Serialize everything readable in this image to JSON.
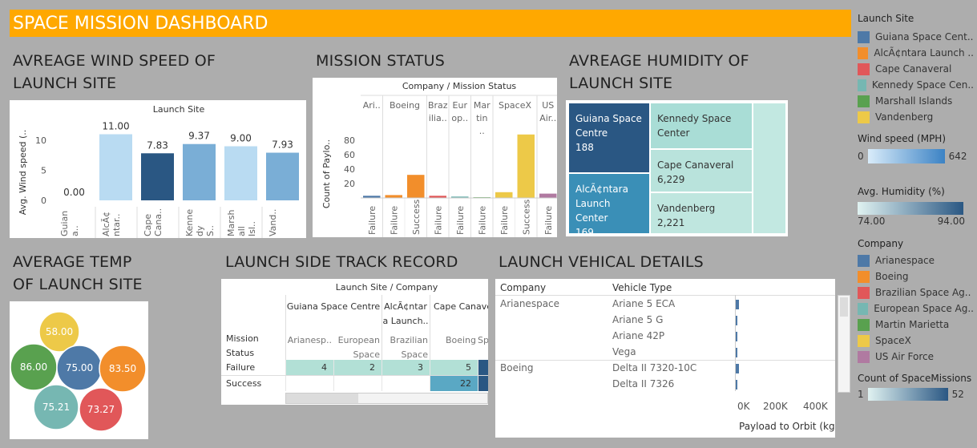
{
  "dashboard_title": "SPACE MISSION DASHBOARD",
  "sections": {
    "wind": "AVREAGE WIND SPEED OF LAUNCH SITE",
    "status": "MISSION STATUS",
    "humidity": "AVREAGE HUMIDITY OF LAUNCH SITE",
    "temp": "AVERAGE TEMP OF LAUNCH SITE",
    "track": "LAUNCH SIDE TRACK RECORD",
    "vehicle": "LAUNCH VEHICAL DETAILS"
  },
  "colors": {
    "banner": "#ffa800",
    "guiana": "#4e79a7",
    "alcantara": "#f28e2b",
    "cape": "#e15759",
    "kennedy": "#76b7b2",
    "marshall": "#59a14f",
    "vandenberg": "#edc948",
    "spacex": "#edc948",
    "usaf": "#b07aa1"
  },
  "wind_chart": {
    "header": "Launch Site",
    "ylabel": "Avg. Wind speed (..",
    "yticks": [
      "0",
      "5",
      "10"
    ],
    "bars": [
      {
        "label": "0.00",
        "cat": "Guian a..",
        "value": 0.0,
        "color": "#b9dbf2"
      },
      {
        "label": "11.00",
        "cat": "AlcÃ¢ ntar..",
        "value": 11.0,
        "color": "#b9dbf2"
      },
      {
        "label": "7.83",
        "cat": "Cape Cana..",
        "value": 7.83,
        "color": "#2a5783"
      },
      {
        "label": "9.37",
        "cat": "Kenne dy S..",
        "value": 9.37,
        "color": "#7aaed6"
      },
      {
        "label": "9.00",
        "cat": "Marsh all Isl..",
        "value": 9.0,
        "color": "#b9dbf2"
      },
      {
        "label": "7.93",
        "cat": "Vand..",
        "value": 7.93,
        "color": "#7aaed6"
      }
    ],
    "ymax": 12
  },
  "status_chart": {
    "header": "Company / Mission Status",
    "ylabel": "Count of Paylo..",
    "yticks": [
      "20",
      "40",
      "60",
      "80"
    ],
    "groups": [
      "Ari..",
      "Boeing",
      "Braz ilia..",
      "Eur op..",
      "Mar tin ..",
      "SpaceX",
      "US Air.."
    ],
    "bars": [
      {
        "cat": "Failure",
        "value": 3,
        "color": "#4e79a7"
      },
      {
        "cat": "Failure",
        "value": 4,
        "color": "#f28e2b"
      },
      {
        "cat": "Success",
        "value": 32,
        "color": "#f28e2b"
      },
      {
        "cat": "Failure",
        "value": 3,
        "color": "#e15759"
      },
      {
        "cat": "Failure",
        "value": 2,
        "color": "#76b7b2"
      },
      {
        "cat": "Failure",
        "value": 1,
        "color": "#59a14f"
      },
      {
        "cat": "Failure",
        "value": 8,
        "color": "#edc948"
      },
      {
        "cat": "Success",
        "value": 88,
        "color": "#edc948"
      },
      {
        "cat": "Failure",
        "value": 6,
        "color": "#b07aa1"
      }
    ],
    "ymax": 100
  },
  "treemap": [
    {
      "name": "Guiana Space Centre",
      "value": "188",
      "color": "#2a5783"
    },
    {
      "name": "AlcÃ¢ntara Launch Center",
      "value": "169",
      "color": "#3a8fb7"
    },
    {
      "name": "Kennedy Space Center",
      "value": "",
      "color": "#a9ddd6"
    },
    {
      "name": "Cape Canaveral",
      "value": "6,229",
      "color": "#b9e3dc"
    },
    {
      "name": "Vandenberg",
      "value": "2,221",
      "color": "#bfe6df"
    },
    {
      "name": "",
      "value": "",
      "color": "#c2e8e1"
    }
  ],
  "bubbles": [
    {
      "value": "58.00",
      "color": "#edc948"
    },
    {
      "value": "86.00",
      "color": "#59a14f"
    },
    {
      "value": "75.00",
      "color": "#4e79a7"
    },
    {
      "value": "83.50",
      "color": "#f28e2b"
    },
    {
      "value": "75.21",
      "color": "#76b7b2"
    },
    {
      "value": "73.27",
      "color": "#e15759"
    }
  ],
  "track": {
    "header": "Launch Site / Company",
    "row_header": "Mission Status",
    "sites": [
      "Guiana Space Centre",
      "AlcÃ¢ntar a Launch..",
      "Cape Canave.."
    ],
    "companies": [
      "Arianesp..",
      "European Space Ag..",
      "Brazilian Space Ag..",
      "Boeing",
      "Sp"
    ],
    "rows": [
      {
        "label": "Failure",
        "cells": [
          "4",
          "2",
          "3",
          "5",
          ""
        ]
      },
      {
        "label": "Success",
        "cells": [
          "",
          "",
          "",
          "22",
          ""
        ]
      }
    ]
  },
  "vehicle": {
    "col_company": "Company",
    "col_type": "Vehicle Type",
    "groups": [
      {
        "company": "Arianespace",
        "types": [
          "Ariane 5 ECA",
          "Ariane 5 G",
          "Ariane 42P",
          "Vega"
        ]
      },
      {
        "company": "Boeing",
        "types": [
          "Delta II 7320-10C",
          "Delta II 7326"
        ]
      }
    ],
    "axis_ticks": [
      "0K",
      "200K",
      "400K"
    ],
    "axis_label": "Payload to Orbit (kg)"
  },
  "legend": {
    "site_title": "Launch Site",
    "sites": [
      {
        "label": "Guiana Space Cent..",
        "color": "#4e79a7"
      },
      {
        "label": "AlcÃ¢ntara Launch ..",
        "color": "#f28e2b"
      },
      {
        "label": "Cape Canaveral",
        "color": "#e15759"
      },
      {
        "label": "Kennedy Space Cen..",
        "color": "#76b7b2"
      },
      {
        "label": "Marshall Islands",
        "color": "#59a14f"
      },
      {
        "label": "Vandenberg",
        "color": "#edc948"
      }
    ],
    "wind_title": "Wind speed (MPH)",
    "wind_min": "0",
    "wind_max": "642",
    "hum_title": "Avg. Humidity (%)",
    "hum_min": "74.00",
    "hum_max": "94.00",
    "company_title": "Company",
    "companies": [
      {
        "label": "Arianespace",
        "color": "#4e79a7"
      },
      {
        "label": "Boeing",
        "color": "#f28e2b"
      },
      {
        "label": "Brazilian Space Ag..",
        "color": "#e15759"
      },
      {
        "label": "European Space Ag..",
        "color": "#76b7b2"
      },
      {
        "label": "Martin Marietta",
        "color": "#59a14f"
      },
      {
        "label": "SpaceX",
        "color": "#edc948"
      },
      {
        "label": "US Air Force",
        "color": "#b07aa1"
      }
    ],
    "count_title": "Count of SpaceMissions",
    "count_min": "1",
    "count_max": "52"
  }
}
